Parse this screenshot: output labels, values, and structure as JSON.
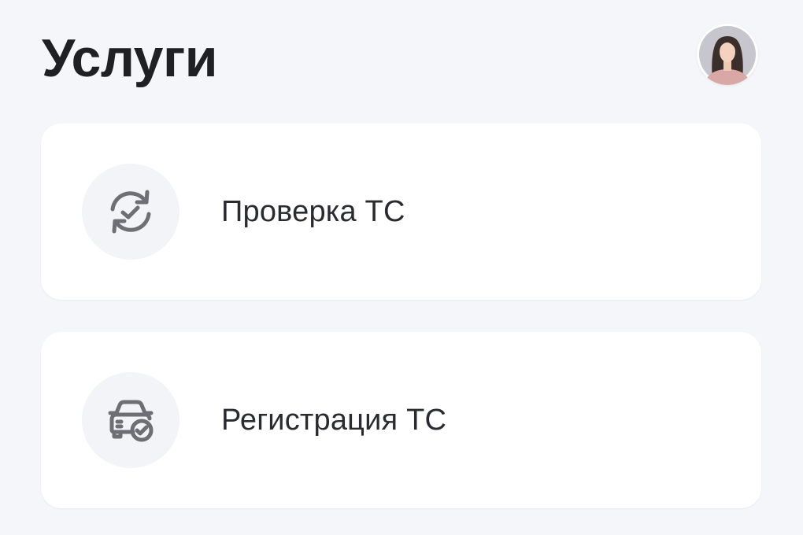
{
  "header": {
    "title": "Услуги",
    "avatar_icon": "user-avatar-icon"
  },
  "services": [
    {
      "label": "Проверка ТС",
      "icon": "refresh-check-icon"
    },
    {
      "label": "Регистрация ТС",
      "icon": "car-check-icon"
    }
  ],
  "colors": {
    "background": "#f5f6fa",
    "card": "#ffffff",
    "icon_circle": "#f3f4f8",
    "icon": "#6e6f74",
    "title": "#1f2024"
  }
}
